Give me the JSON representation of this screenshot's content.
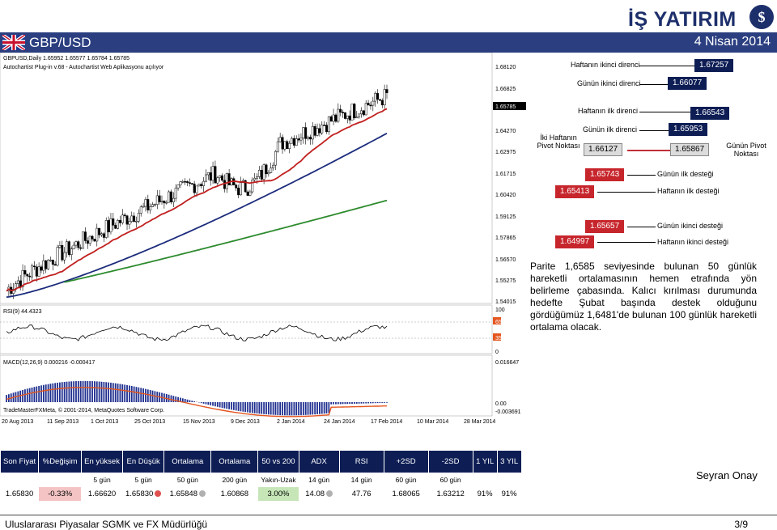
{
  "header": {
    "logo_text": "İŞ YATIRIM",
    "logo_mark": "$",
    "pair": "GBP/USD",
    "date": "4 Nisan 2014"
  },
  "chart": {
    "price_info": "GBPUSD,Daily 1.65952 1.65577 1.65784 1.65785",
    "indicator_info": "Autochartist Plug-in v.68 - Autochartist Web Aplikasyonu açılıyor",
    "rsi_label": "RSI(9) 44.4323",
    "macd_label": "MACD(12,26,9) 0.000216 -0.000417",
    "copyright": "TradeMasterFXMeta, © 2001-2014, MetaQuotes Software Corp.",
    "price_axis": [
      "1.68120",
      "1.66825",
      "1.65785",
      "1.64270",
      "1.62975",
      "1.61715",
      "1.60420",
      "1.59125",
      "1.57865",
      "1.56570",
      "1.55275",
      "1.54015"
    ],
    "current_price": "1.65785",
    "rsi_axis": [
      "100",
      "65",
      "35",
      "0"
    ],
    "macd_axis": [
      "0.016647",
      "0.00",
      "-0.003691"
    ],
    "dates": [
      "20 Aug 2013",
      "11 Sep 2013",
      "1 Oct 2013",
      "25 Oct 2013",
      "15 Nov 2013",
      "9 Dec 2013",
      "2 Jan 2014",
      "24 Jan 2014",
      "17 Feb 2014",
      "10 Mar 2014",
      "28 Mar 2014"
    ],
    "colors": {
      "candle_up": "#000000",
      "candle_down": "#000000",
      "ma50": "#c0201f",
      "ma100": "#1c2c7c",
      "ma200": "#2e8b2e",
      "rsi": "#000000",
      "macd_hist": "#1f2f8f",
      "macd_signal": "#e4551f"
    }
  },
  "pivot": {
    "weekly_r2_label": "Haftanın ikinci direnci",
    "weekly_r2": "1.67257",
    "daily_r2_label": "Günün ikinci direnci",
    "daily_r2": "1.66077",
    "weekly_r1_label": "Haftanın ilk direnci",
    "weekly_r1": "1.66543",
    "daily_r1_label": "Günün ilk direnci",
    "daily_r1": "1.65953",
    "weekly_pivot_label": "İki Haftanın Pivot Noktası",
    "weekly_pivot": "1.66127",
    "daily_pivot": "1.65867",
    "daily_pivot_label": "Günün Pivot Noktası",
    "daily_s1": "1.65743",
    "daily_s1_label": "Günün ilk desteği",
    "weekly_s1": "1.65413",
    "weekly_s1_label": "Haftanın ilk desteği",
    "daily_s2": "1.65657",
    "daily_s2_label": "Günün ikinci desteği",
    "weekly_s2": "1.64997",
    "weekly_s2_label": "Haftanın ikinci desteği"
  },
  "comment": "Parite 1,6585 seviyesinde bulunan 50 günlük hareketli ortalamasının hemen etrafında yön belirleme çabasında. Kalıcı kırılması durumunda hedefte Şubat başında destek olduğunu gördüğümüz 1,6481'de bulunan 100 günlük hareketli ortalama olacak.",
  "table": {
    "headers": [
      "Son Fiyat",
      "%Değişim",
      "En yüksek",
      "En Düşük",
      "Ortalama",
      "Ortalama",
      "50 vs 200",
      "ADX",
      "RSI",
      "+2SD",
      "-2SD",
      "1 YIL",
      "3 YIL"
    ],
    "subheaders": [
      "",
      "",
      "5 gün",
      "5 gün",
      "50 gün",
      "200 gün",
      "Yakın-Uzak",
      "14 gün",
      "14 gün",
      "60 gün",
      "60 gün",
      "",
      ""
    ],
    "values": [
      "1.65830",
      "-0.33%",
      "1.66620",
      "1.65830",
      "1.65848",
      "1.60868",
      "3.00%",
      "14.08",
      "47.76",
      "1.68065",
      "1.63212",
      "91%",
      "91%"
    ],
    "colors": {
      "neg": "#f4c4c4",
      "pos": "#c6e6b8",
      "red_dot": "#e05050",
      "gray_dot": "#b0b0b0"
    }
  },
  "author": "Seyran Onay",
  "footer": {
    "left": "Uluslararası Piyasalar SGMK ve FX Müdürlüğü",
    "right": "3/9"
  }
}
